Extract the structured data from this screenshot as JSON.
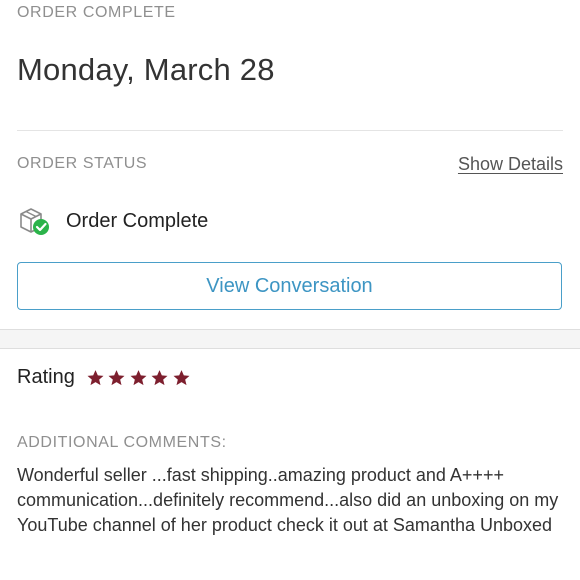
{
  "order": {
    "complete_label": "ORDER COMPLETE",
    "date": "Monday, March 28"
  },
  "status": {
    "label": "ORDER STATUS",
    "show_details": "Show Details",
    "text": "Order Complete",
    "icon": "package-check-icon",
    "check_color": "#2bb34a"
  },
  "actions": {
    "view_conversation": "View Conversation",
    "accent_color": "#3d95c3"
  },
  "rating": {
    "label": "Rating",
    "value": 5,
    "max": 5,
    "star_color": "#7d1f2e"
  },
  "comments": {
    "label": "ADDITIONAL COMMENTS:",
    "text": "Wonderful seller ...fast shipping..amazing product and A++++ communication...definitely recommend...also did an unboxing on my YouTube channel of her product check it out at Samantha Unboxed"
  }
}
